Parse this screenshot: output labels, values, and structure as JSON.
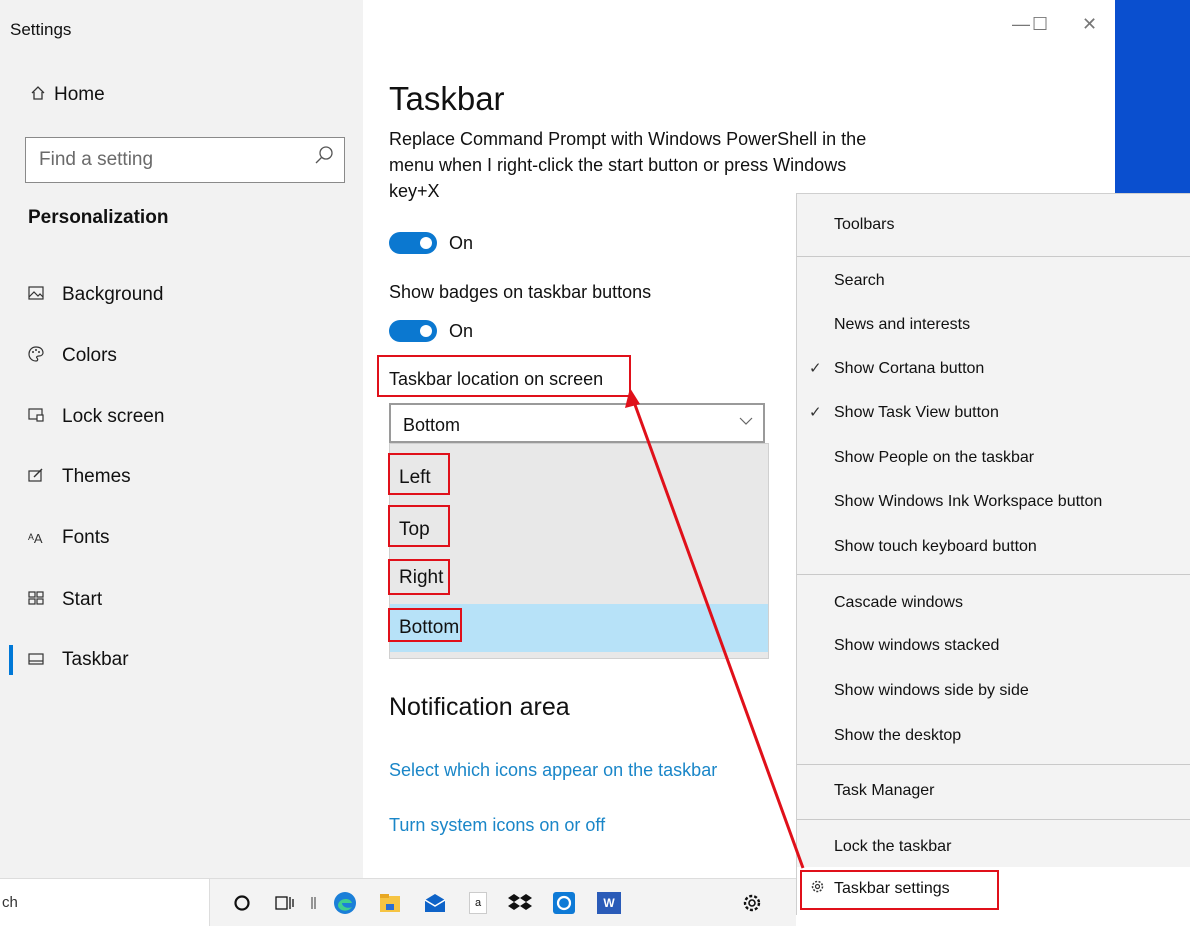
{
  "window": {
    "title": "Settings",
    "minimize_glyph": "—",
    "maximize_glyph": "☐",
    "close_glyph": "✕"
  },
  "sidebar": {
    "home": {
      "icon": "home-icon",
      "label": "Home"
    },
    "search": {
      "placeholder": "Find a setting",
      "icon": "search-icon"
    },
    "section_title": "Personalization",
    "items": [
      {
        "icon": "background-icon",
        "label": "Background"
      },
      {
        "icon": "colors-icon",
        "label": "Colors"
      },
      {
        "icon": "lock-screen-icon",
        "label": "Lock screen"
      },
      {
        "icon": "themes-icon",
        "label": "Themes"
      },
      {
        "icon": "fonts-icon",
        "label": "Fonts"
      },
      {
        "icon": "start-icon",
        "label": "Start"
      },
      {
        "icon": "taskbar-icon",
        "label": "Taskbar",
        "active": true
      }
    ]
  },
  "main": {
    "title": "Taskbar",
    "powershell_text": "Replace Command Prompt with Windows PowerShell in the menu when I right-click the start button or press Windows key+X",
    "powershell_toggle": "On",
    "badges_label": "Show badges on taskbar buttons",
    "badges_toggle": "On",
    "location_label": "Taskbar location on screen",
    "location_value": "Bottom",
    "location_options": [
      "Left",
      "Top",
      "Right",
      "Bottom"
    ],
    "selected_option": "Bottom",
    "notification_title": "Notification area",
    "link_icons": "Select which icons appear on the taskbar",
    "link_system": "Turn system icons on or off"
  },
  "context_menu": {
    "groups": [
      [
        {
          "label": "Toolbars",
          "checked": false
        }
      ],
      [
        {
          "label": "Search",
          "checked": false
        },
        {
          "label": "News and interests",
          "checked": false
        },
        {
          "label": "Show Cortana button",
          "checked": true
        },
        {
          "label": "Show Task View button",
          "checked": true
        },
        {
          "label": "Show People on the taskbar",
          "checked": false
        },
        {
          "label": "Show Windows Ink Workspace button",
          "checked": false
        },
        {
          "label": "Show touch keyboard button",
          "checked": false
        }
      ],
      [
        {
          "label": "Cascade windows",
          "checked": false
        },
        {
          "label": "Show windows stacked",
          "checked": false
        },
        {
          "label": "Show windows side by side",
          "checked": false
        },
        {
          "label": "Show the desktop",
          "checked": false
        }
      ],
      [
        {
          "label": "Task Manager",
          "checked": false
        }
      ],
      [
        {
          "label": "Lock the taskbar",
          "checked": false
        }
      ]
    ],
    "taskbar_settings": {
      "icon": "gear-icon",
      "label": "Taskbar settings"
    },
    "check_glyph": "✓"
  },
  "taskbar": {
    "search_text": "ch",
    "icons": [
      "cortana-icon",
      "task-view-icon",
      "separator-icon",
      "edge-icon",
      "file-explorer-icon",
      "mail-icon",
      "amazon-icon",
      "dropbox-icon",
      "cortana-app-icon",
      "word-icon",
      "settings-icon"
    ],
    "amazon_glyph": "a",
    "word_glyph": "W"
  },
  "colors": {
    "accent": "#0078d7",
    "link": "#1a86c8",
    "annotation_red": "#e0101a",
    "desktop_blue": "#0a4fcf",
    "selected_option_bg": "#b7e2f8"
  }
}
